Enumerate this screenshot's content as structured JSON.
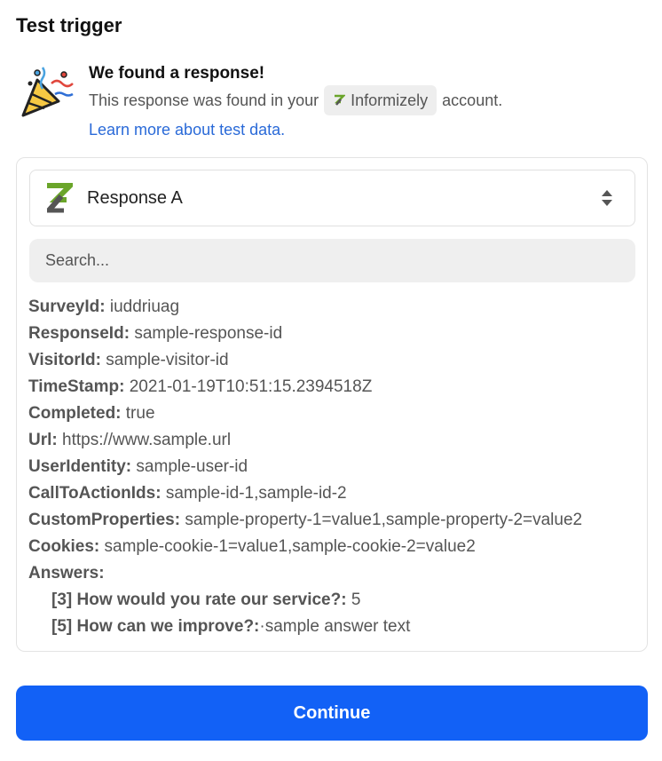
{
  "page": {
    "title": "Test trigger"
  },
  "found": {
    "heading": "We found a response!",
    "subtext_before": "This response was found in your",
    "account_name": "Informizely",
    "subtext_after": "account.",
    "learn_more": "Learn more about test data."
  },
  "selector": {
    "label": "Response A"
  },
  "search": {
    "placeholder": "Search..."
  },
  "fields": [
    {
      "key": "SurveyId:",
      "value": "iuddriuag"
    },
    {
      "key": "ResponseId:",
      "value": "sample-response-id"
    },
    {
      "key": "VisitorId:",
      "value": "sample-visitor-id"
    },
    {
      "key": "TimeStamp:",
      "value": "2021-01-19T10:51:15.2394518Z"
    },
    {
      "key": "Completed:",
      "value": "true"
    },
    {
      "key": "Url:",
      "value": "https://www.sample.url"
    },
    {
      "key": "UserIdentity:",
      "value": "sample-user-id"
    },
    {
      "key": "CallToActionIds:",
      "value": "sample-id-1,sample-id-2"
    },
    {
      "key": "CustomProperties:",
      "value": "sample-property-1=value1,sample-property-2=value2"
    },
    {
      "key": "Cookies:",
      "value": "sample-cookie-1=value1,sample-cookie-2=value2"
    },
    {
      "key": "Answers:",
      "value": ""
    }
  ],
  "answers": [
    {
      "key": "[3] How would you rate our service?:",
      "value": "5"
    },
    {
      "key": "[5] How can we improve?:",
      "value": "·sample answer text"
    }
  ],
  "actions": {
    "continue_label": "Continue"
  },
  "colors": {
    "primary": "#1261f6",
    "link": "#2a6ad8",
    "brand": "#6aa52a"
  }
}
